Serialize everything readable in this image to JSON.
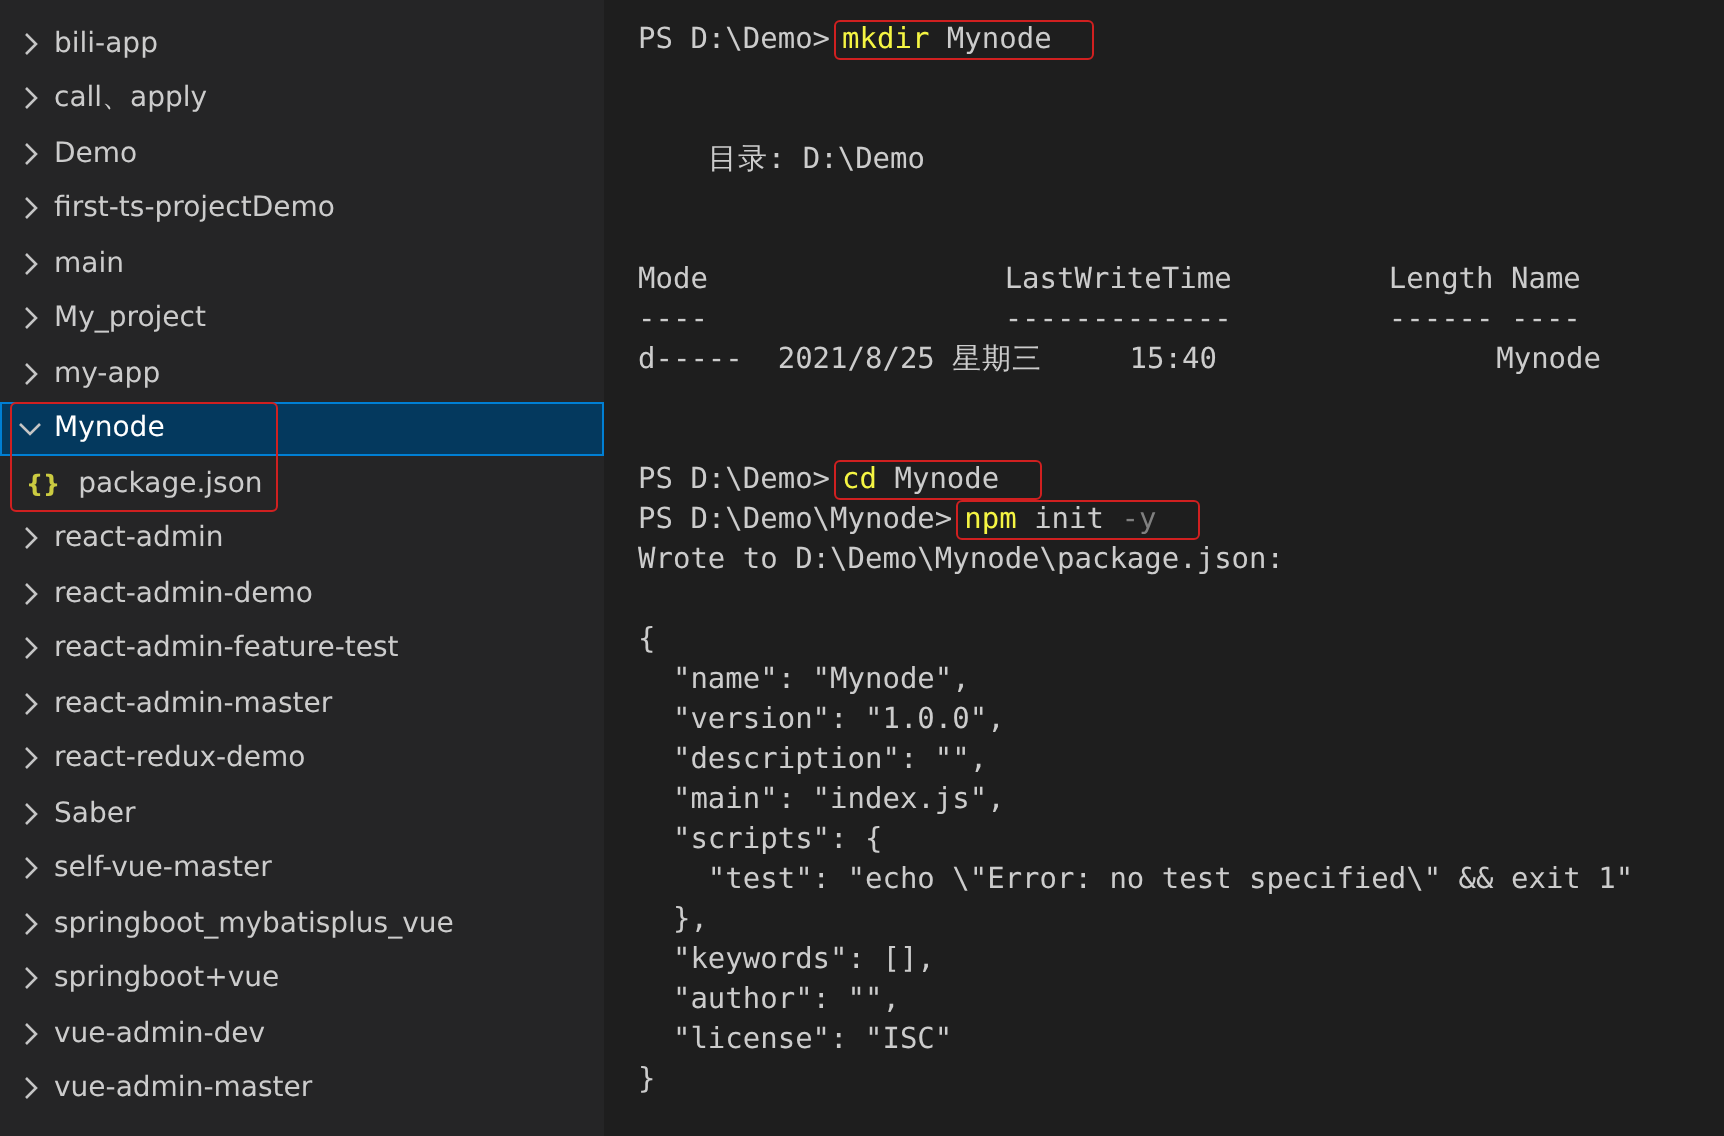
{
  "sidebar": {
    "items": [
      {
        "label": "bili-app",
        "expanded": false,
        "selected": false,
        "annotated": false
      },
      {
        "label": "call、apply",
        "expanded": false,
        "selected": false,
        "annotated": false
      },
      {
        "label": "Demo",
        "expanded": false,
        "selected": false,
        "annotated": false
      },
      {
        "label": "first-ts-projectDemo",
        "expanded": false,
        "selected": false,
        "annotated": false
      },
      {
        "label": "main",
        "expanded": false,
        "selected": false,
        "annotated": false
      },
      {
        "label": "My_project",
        "expanded": false,
        "selected": false,
        "annotated": false
      },
      {
        "label": "my-app",
        "expanded": false,
        "selected": false,
        "annotated": false
      },
      {
        "label": "Mynode",
        "expanded": true,
        "selected": true,
        "annotated": true,
        "children": [
          {
            "label": "package.json",
            "icon_text": "{}",
            "selected": false
          }
        ]
      },
      {
        "label": "react-admin",
        "expanded": false,
        "selected": false,
        "annotated": false
      },
      {
        "label": "react-admin-demo",
        "expanded": false,
        "selected": false,
        "annotated": false
      },
      {
        "label": "react-admin-feature-test",
        "expanded": false,
        "selected": false,
        "annotated": false
      },
      {
        "label": "react-admin-master",
        "expanded": false,
        "selected": false,
        "annotated": false
      },
      {
        "label": "react-redux-demo",
        "expanded": false,
        "selected": false,
        "annotated": false
      },
      {
        "label": "Saber",
        "expanded": false,
        "selected": false,
        "annotated": false
      },
      {
        "label": "self-vue-master",
        "expanded": false,
        "selected": false,
        "annotated": false
      },
      {
        "label": "springboot_mybatisplus_vue",
        "expanded": false,
        "selected": false,
        "annotated": false
      },
      {
        "label": "springboot+vue",
        "expanded": false,
        "selected": false,
        "annotated": false
      },
      {
        "label": "vue-admin-dev",
        "expanded": false,
        "selected": false,
        "annotated": false
      },
      {
        "label": "vue-admin-master",
        "expanded": false,
        "selected": false,
        "annotated": false
      }
    ]
  },
  "terminal": {
    "lines": [
      {
        "kind": "command",
        "prompt": "PS D:\\Demo>",
        "command": "mkdir",
        "args": "Mynode",
        "annotated": true
      },
      {
        "kind": "blank"
      },
      {
        "kind": "blank"
      },
      {
        "kind": "text",
        "text": "    目录: D:\\Demo"
      },
      {
        "kind": "blank"
      },
      {
        "kind": "blank"
      },
      {
        "kind": "text",
        "text": "Mode                 LastWriteTime         Length Name"
      },
      {
        "kind": "text",
        "text": "----                 -------------         ------ ----"
      },
      {
        "kind": "text",
        "text": "d-----  2021/8/25 星期三     15:40                Mynode"
      },
      {
        "kind": "blank"
      },
      {
        "kind": "blank"
      },
      {
        "kind": "command",
        "prompt": "PS D:\\Demo>",
        "command": "cd",
        "args": "Mynode",
        "annotated": true
      },
      {
        "kind": "command",
        "prompt": "PS D:\\Demo\\Mynode>",
        "command": "npm",
        "args": "init",
        "flag": "-y",
        "annotated": true
      },
      {
        "kind": "text",
        "text": "Wrote to D:\\Demo\\Mynode\\package.json:"
      },
      {
        "kind": "blank"
      },
      {
        "kind": "text",
        "text": "{"
      },
      {
        "kind": "text",
        "text": "  \"name\": \"Mynode\","
      },
      {
        "kind": "text",
        "text": "  \"version\": \"1.0.0\","
      },
      {
        "kind": "text",
        "text": "  \"description\": \"\","
      },
      {
        "kind": "text",
        "text": "  \"main\": \"index.js\","
      },
      {
        "kind": "text",
        "text": "  \"scripts\": {"
      },
      {
        "kind": "text",
        "text": "    \"test\": \"echo \\\"Error: no test specified\\\" && exit 1\""
      },
      {
        "kind": "text",
        "text": "  },"
      },
      {
        "kind": "text",
        "text": "  \"keywords\": [],"
      },
      {
        "kind": "text",
        "text": "  \"author\": \"\","
      },
      {
        "kind": "text",
        "text": "  \"license\": \"ISC\""
      },
      {
        "kind": "text",
        "text": "}"
      }
    ]
  }
}
